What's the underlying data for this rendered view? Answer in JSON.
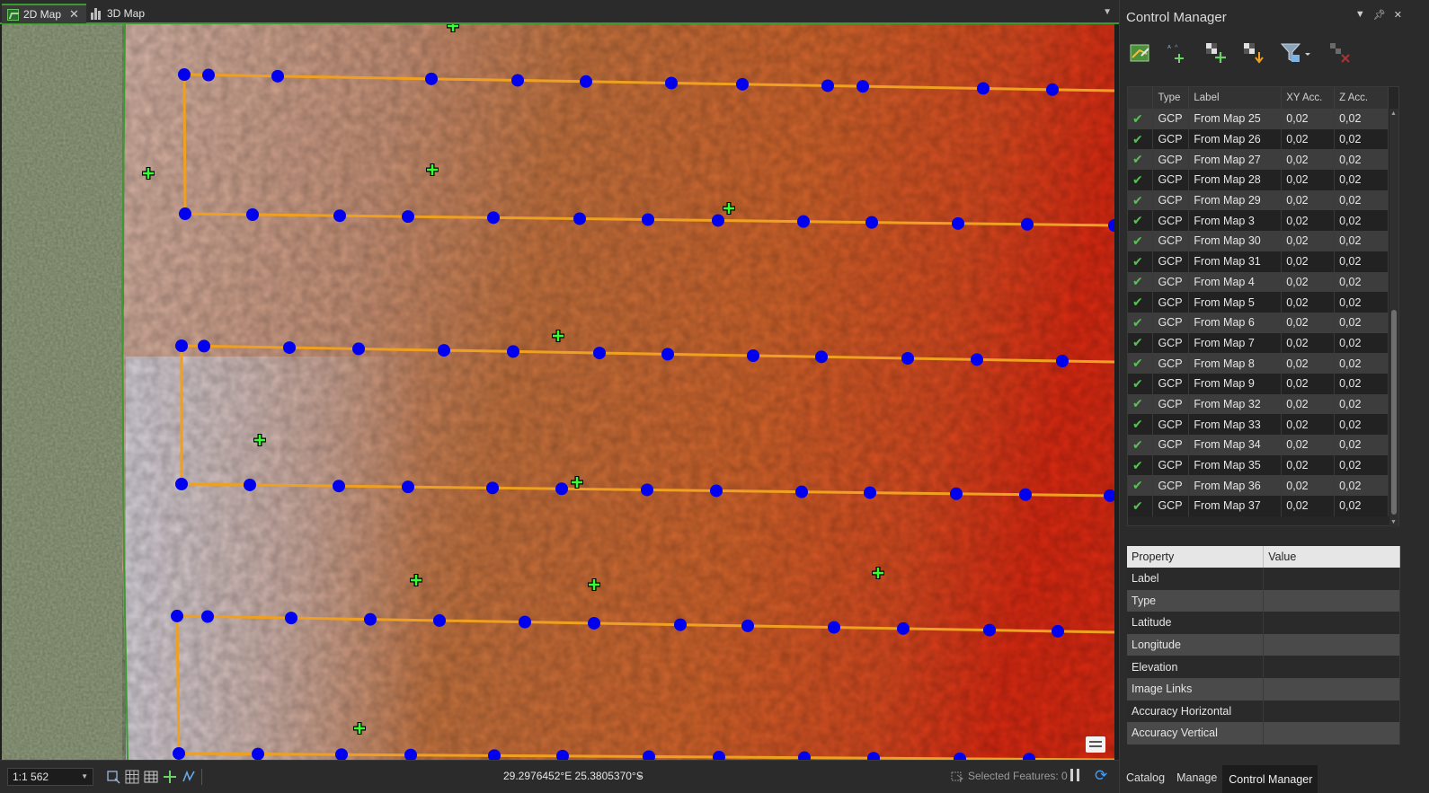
{
  "tabs": [
    {
      "label": "2D Map",
      "active": true
    },
    {
      "label": "3D Map",
      "active": false
    }
  ],
  "status": {
    "scale": "1:1 562",
    "coordinates": "29.2976452°E 25.3805370°S",
    "selected_features": "Selected Features: 0"
  },
  "pane": {
    "title": "Control Manager",
    "toolbar": [
      "import-gcp-icon",
      "add-tie-point-icon",
      "add-gcp-icon",
      "download-gcp-icon",
      "filter-icon",
      "delete-point-icon"
    ],
    "columns": [
      "Type",
      "Label",
      "XY Acc.",
      "Z Acc."
    ],
    "rows": [
      [
        "GCP",
        "From Map 25",
        "0,02",
        "0,02"
      ],
      [
        "GCP",
        "From Map 26",
        "0,02",
        "0,02"
      ],
      [
        "GCP",
        "From Map 27",
        "0,02",
        "0,02"
      ],
      [
        "GCP",
        "From Map 28",
        "0,02",
        "0,02"
      ],
      [
        "GCP",
        "From Map 29",
        "0,02",
        "0,02"
      ],
      [
        "GCP",
        "From Map 3",
        "0,02",
        "0,02"
      ],
      [
        "GCP",
        "From Map 30",
        "0,02",
        "0,02"
      ],
      [
        "GCP",
        "From Map 31",
        "0,02",
        "0,02"
      ],
      [
        "GCP",
        "From Map 4",
        "0,02",
        "0,02"
      ],
      [
        "GCP",
        "From Map 5",
        "0,02",
        "0,02"
      ],
      [
        "GCP",
        "From Map 6",
        "0,02",
        "0,02"
      ],
      [
        "GCP",
        "From Map 7",
        "0,02",
        "0,02"
      ],
      [
        "GCP",
        "From Map 8",
        "0,02",
        "0,02"
      ],
      [
        "GCP",
        "From Map 9",
        "0,02",
        "0,02"
      ],
      [
        "GCP",
        "From Map 32",
        "0,02",
        "0,02"
      ],
      [
        "GCP",
        "From Map 33",
        "0,02",
        "0,02"
      ],
      [
        "GCP",
        "From Map 34",
        "0,02",
        "0,02"
      ],
      [
        "GCP",
        "From Map 35",
        "0,02",
        "0,02"
      ],
      [
        "GCP",
        "From Map 36",
        "0,02",
        "0,02"
      ],
      [
        "GCP",
        "From Map 37",
        "0,02",
        "0,02"
      ]
    ],
    "property_columns": [
      "Property",
      "Value"
    ],
    "properties": [
      "Label",
      "Type",
      "Latitude",
      "Longitude",
      "Elevation",
      "Image Links",
      "Accuracy Horizontal",
      "Accuracy Vertical"
    ],
    "bottom_tabs": [
      {
        "label": "Catalog",
        "active": false
      },
      {
        "label": "Manage",
        "active": false
      },
      {
        "label": "Control Manager",
        "active": true
      }
    ]
  },
  "colors": {
    "flight_line": "#f0a020",
    "camera_point": "#0000ee",
    "gcp_marker": "#33ff33",
    "check_mark": "#59c254",
    "accent": "#3c9b2f"
  }
}
